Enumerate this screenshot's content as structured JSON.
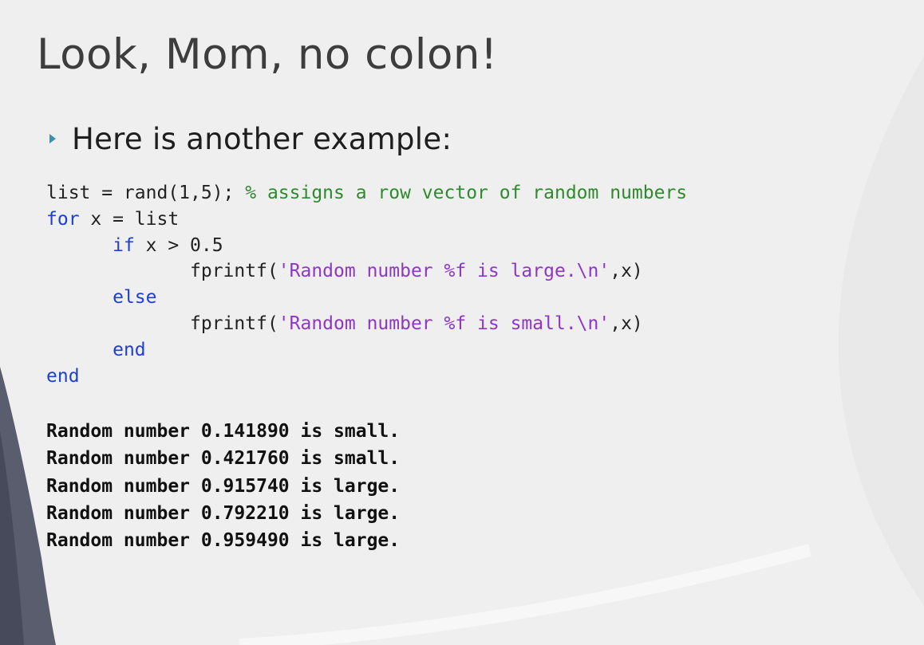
{
  "slide": {
    "title": "Look, Mom, no colon!",
    "bullet": "Here is another example:"
  },
  "code": {
    "l1": {
      "a": "list = rand(1,5); ",
      "comment": "% assigns a row vector of random numbers"
    },
    "l2": {
      "kw": "for",
      "rest": " x = list"
    },
    "l3": {
      "indent": "      ",
      "kw": "if",
      "rest": " x > 0.5"
    },
    "l4": {
      "pre": "             fprintf(",
      "str": "'Random number %f is large.\\n'",
      "post": ",x)"
    },
    "l5": {
      "indent": "      ",
      "kw": "else"
    },
    "l6": {
      "pre": "             fprintf(",
      "str": "'Random number %f is small.\\n'",
      "post": ",x)"
    },
    "l7": {
      "indent": "      ",
      "kw": "end"
    },
    "l8": {
      "kw": "end"
    }
  },
  "output_lines": [
    "Random number 0.141890 is small.",
    "Random number 0.421760 is small.",
    "Random number 0.915740 is large.",
    "Random number 0.792210 is large.",
    "Random number 0.959490 is large."
  ],
  "colors": {
    "keyword": "#1f3fd0",
    "string": "#8e37c6",
    "comment": "#2f8a2f",
    "bullet": "#3f8fb0"
  }
}
